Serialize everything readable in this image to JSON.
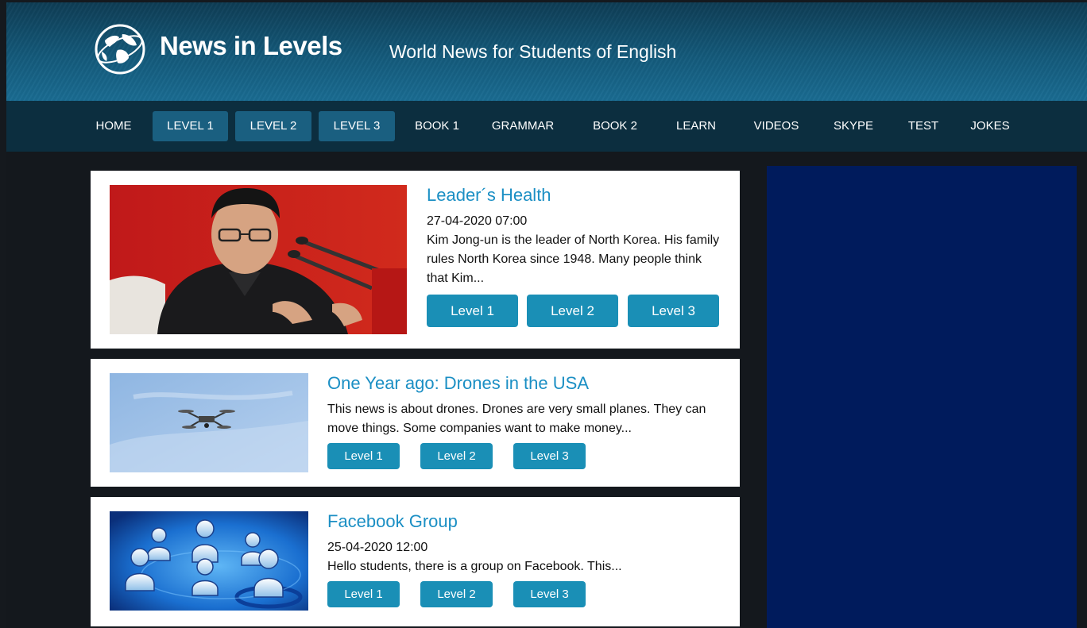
{
  "header": {
    "logo_text": "News in Levels",
    "tagline": "World News for Students of English",
    "logo_icon": "globe-icon"
  },
  "nav": [
    {
      "label": "HOME",
      "active": false
    },
    {
      "label": "LEVEL 1",
      "active": true
    },
    {
      "label": "LEVEL 2",
      "active": true
    },
    {
      "label": "LEVEL 3",
      "active": true
    },
    {
      "label": "BOOK 1",
      "active": false
    },
    {
      "label": "GRAMMAR",
      "active": false
    },
    {
      "label": "BOOK 2",
      "active": false
    },
    {
      "label": "LEARN",
      "active": false
    },
    {
      "label": "VIDEOS",
      "active": false
    },
    {
      "label": "SKYPE",
      "active": false
    },
    {
      "label": "TEST",
      "active": false
    },
    {
      "label": "JOKES",
      "active": false
    }
  ],
  "articles": [
    {
      "title": "Leader´s Health",
      "date": "27-04-2020 07:00",
      "excerpt": "Kim Jong-un is the leader of North Korea. His family rules North Korea since 1948. Many people think that Kim...",
      "buttons": [
        "Level 1",
        "Level 2",
        "Level 3"
      ]
    },
    {
      "title": "One Year ago: Drones in the USA",
      "excerpt": "This news is about drones. Drones are very small planes. They can move things. Some companies want to make money...",
      "buttons": [
        "Level 1",
        "Level 2",
        "Level 3"
      ]
    },
    {
      "title": "Facebook Group",
      "date": "25-04-2020 12:00",
      "excerpt": "Hello students, there is a group on Facebook. This...",
      "buttons": [
        "Level 1",
        "Level 2",
        "Level 3"
      ]
    }
  ],
  "colors": {
    "header_top": "#0e3d55",
    "nav_bg": "#0c2e3f",
    "nav_active": "#1a5f80",
    "title_blue": "#1b8fc4",
    "button_blue": "#1a8fb6",
    "sidebar_bg": "#001b5c",
    "page_bg": "#14181d"
  }
}
